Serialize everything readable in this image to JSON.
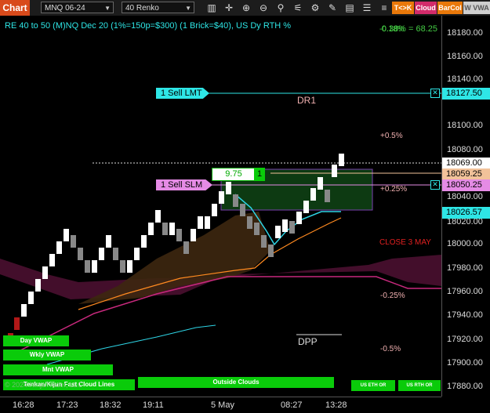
{
  "toolbar": {
    "chart_tab": "Chart",
    "instrument": "MNQ 06-24",
    "bar_type": "40 Renko",
    "tools": [
      "bars-icon",
      "crosshair-icon",
      "zoom-in-icon",
      "zoom-out-icon",
      "properties-icon",
      "indicators-icon",
      "strategies-icon",
      "draw-icon",
      "layout-icon",
      "settings-icon"
    ],
    "tk_label": "T<>K",
    "cloud_label": "Cloud",
    "barcol_label": "BarCol",
    "vwap_label": "W VWA"
  },
  "chart": {
    "info_line": "RE 40 to 50 (M)NQ Dec 20 (1%=150p=$300) (1 Brick=$40), US Dy RTH %",
    "top_right": "0.38% = 68.25",
    "top_right_under": "-0.18%",
    "dr1": "DR1",
    "dpp": "DPP",
    "pct_plus05": "+0.5%",
    "pct_plus025": "+0.25%",
    "pct_minus025": "-0.25%",
    "pct_minus05": "-0.5%",
    "close_label": "CLOSE 3 MAY",
    "position_value": "9.75",
    "position_qty": "1"
  },
  "orders": {
    "sell_lmt": "1 Sell LMT",
    "sell_slm": "1 Sell SLM"
  },
  "price_axis": {
    "ticks": [
      "18180.00",
      "18160.00",
      "18140.00",
      "18100.00",
      "18080.00",
      "18040.00",
      "18020.00",
      "18000.00",
      "17980.00",
      "17960.00",
      "17940.00",
      "17920.00",
      "17900.00",
      "17880.00"
    ],
    "labels": {
      "lmt": "18127.50",
      "last": "18069.00",
      "entry": "18059.25",
      "slm": "18050.25",
      "ma": "18026.57"
    },
    "colors": {
      "lmt": "#2ee6e6",
      "entry": "#f2c29a",
      "slm": "#e58be5",
      "ma": "#2ee6e6"
    }
  },
  "time_axis": {
    "ticks": [
      "16:28",
      "17:23",
      "18:32",
      "19:11",
      "5 May",
      "08:27",
      "13:28"
    ]
  },
  "bottom_bars": {
    "day_vwap": "Day VWAP",
    "wkly_vwap": "Wkly VWAP",
    "mnt_vwap": "Mnt VWAP",
    "tenkan": "Tenkan/Kijun Fast Cloud Lines",
    "copyright": "© 2024 NinjaTrader, LLC",
    "outside_clouds": "Outside Clouds",
    "us_eth_or": "US ETH OR",
    "us_rth_or": "US RTH OR"
  }
}
